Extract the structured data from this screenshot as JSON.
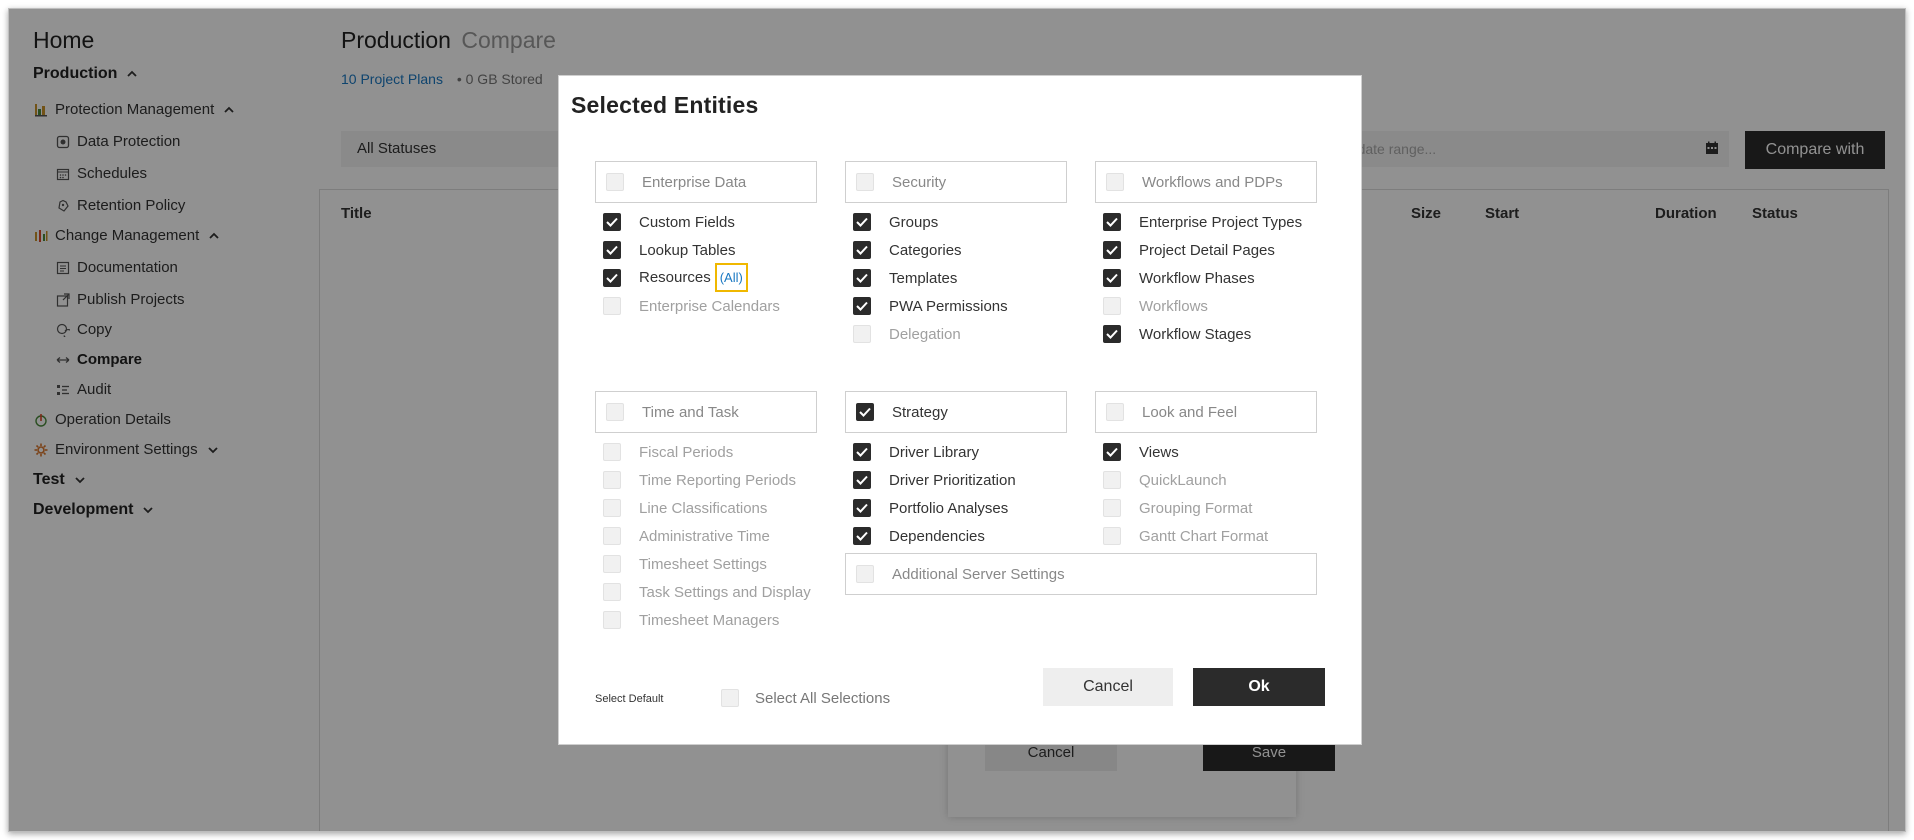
{
  "sidebar": {
    "home": "Home",
    "production": "Production",
    "protection_management": "Protection Management",
    "data_protection": "Data Protection",
    "schedules": "Schedules",
    "retention_policy": "Retention Policy",
    "change_management": "Change Management",
    "documentation": "Documentation",
    "publish_projects": "Publish Projects",
    "copy": "Copy",
    "compare": "Compare",
    "audit": "Audit",
    "operation_details": "Operation Details",
    "environment_settings": "Environment Settings",
    "test": "Test",
    "development": "Development"
  },
  "main": {
    "title": "Production",
    "subtitle": "Compare",
    "project_plans": "10 Project Plans",
    "stored": "• 0 GB Stored",
    "status_filter": "All Statuses",
    "date_placeholder": "ect date range...",
    "compare_with": "Compare with",
    "columns": {
      "title": "Title",
      "size": "Size",
      "start": "Start",
      "duration": "Duration",
      "status": "Status"
    },
    "bg_cancel": "Cancel",
    "bg_save": "Save"
  },
  "modal": {
    "title": "Selected Entities",
    "groups": {
      "enterprise_data": {
        "label": "Enterprise Data",
        "items": [
          "Custom Fields",
          "Lookup Tables",
          "Resources",
          "Enterprise Calendars"
        ],
        "all_link": "(All)"
      },
      "security": {
        "label": "Security",
        "items": [
          "Groups",
          "Categories",
          "Templates",
          "PWA Permissions",
          "Delegation"
        ]
      },
      "workflows": {
        "label": "Workflows and PDPs",
        "items": [
          "Enterprise Project Types",
          "Project Detail Pages",
          "Workflow Phases",
          "Workflows",
          "Workflow Stages"
        ]
      },
      "time_task": {
        "label": "Time and Task",
        "items": [
          "Fiscal Periods",
          "Time Reporting Periods",
          "Line Classifications",
          "Administrative Time",
          "Timesheet Settings",
          "Task Settings and Display",
          "Timesheet Managers"
        ]
      },
      "strategy": {
        "label": "Strategy",
        "items": [
          "Driver Library",
          "Driver Prioritization",
          "Portfolio Analyses",
          "Dependencies"
        ]
      },
      "look_feel": {
        "label": "Look and Feel",
        "items": [
          "Views",
          "QuickLaunch",
          "Grouping Format",
          "Gantt Chart Format"
        ]
      },
      "additional": {
        "label": "Additional Server Settings"
      }
    },
    "select_default": "Select Default",
    "select_all": "Select All Selections",
    "cancel": "Cancel",
    "ok": "Ok"
  }
}
